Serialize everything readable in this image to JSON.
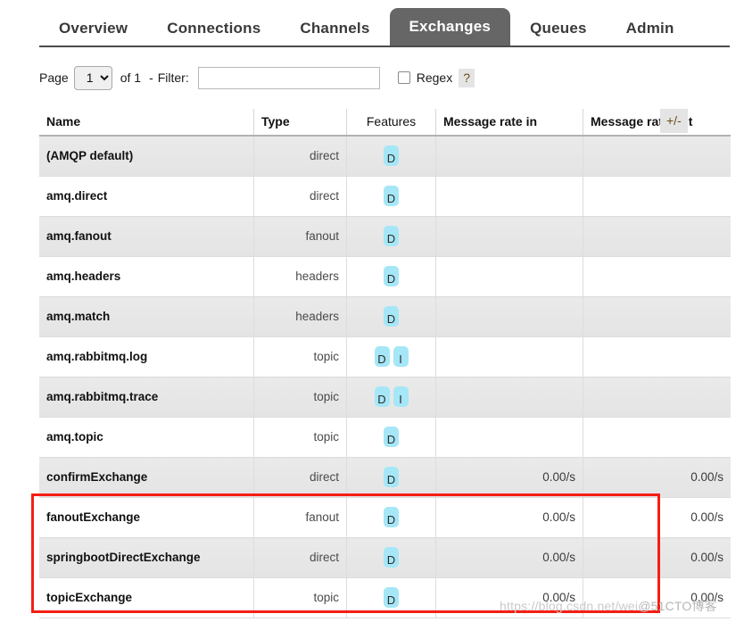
{
  "nav": {
    "tabs": [
      {
        "label": "Overview",
        "active": false
      },
      {
        "label": "Connections",
        "active": false
      },
      {
        "label": "Channels",
        "active": false
      },
      {
        "label": "Exchanges",
        "active": true
      },
      {
        "label": "Queues",
        "active": false
      },
      {
        "label": "Admin",
        "active": false
      }
    ]
  },
  "toolbar": {
    "page_label": "Page",
    "page_value": "1",
    "page_options": [
      "1"
    ],
    "of_label": "of 1",
    "dash_label": "-",
    "filter_label": "Filter:",
    "filter_value": "",
    "filter_placeholder": "",
    "regex_label": "Regex",
    "regex_checked": false,
    "help_label": "?"
  },
  "table": {
    "columns": [
      "Name",
      "Type",
      "Features",
      "Message rate in",
      "Message rate out"
    ],
    "plus_minus_label": "+/-",
    "rows": [
      {
        "name": "(AMQP default)",
        "type": "direct",
        "features": [
          "D"
        ],
        "rate_in": "",
        "rate_out": ""
      },
      {
        "name": "amq.direct",
        "type": "direct",
        "features": [
          "D"
        ],
        "rate_in": "",
        "rate_out": ""
      },
      {
        "name": "amq.fanout",
        "type": "fanout",
        "features": [
          "D"
        ],
        "rate_in": "",
        "rate_out": ""
      },
      {
        "name": "amq.headers",
        "type": "headers",
        "features": [
          "D"
        ],
        "rate_in": "",
        "rate_out": ""
      },
      {
        "name": "amq.match",
        "type": "headers",
        "features": [
          "D"
        ],
        "rate_in": "",
        "rate_out": ""
      },
      {
        "name": "amq.rabbitmq.log",
        "type": "topic",
        "features": [
          "D",
          "I"
        ],
        "rate_in": "",
        "rate_out": ""
      },
      {
        "name": "amq.rabbitmq.trace",
        "type": "topic",
        "features": [
          "D",
          "I"
        ],
        "rate_in": "",
        "rate_out": ""
      },
      {
        "name": "amq.topic",
        "type": "topic",
        "features": [
          "D"
        ],
        "rate_in": "",
        "rate_out": ""
      },
      {
        "name": "confirmExchange",
        "type": "direct",
        "features": [
          "D"
        ],
        "rate_in": "0.00/s",
        "rate_out": "0.00/s"
      },
      {
        "name": "fanoutExchange",
        "type": "fanout",
        "features": [
          "D"
        ],
        "rate_in": "0.00/s",
        "rate_out": "0.00/s"
      },
      {
        "name": "springbootDirectExchange",
        "type": "direct",
        "features": [
          "D"
        ],
        "rate_in": "0.00/s",
        "rate_out": "0.00/s"
      },
      {
        "name": "topicExchange",
        "type": "topic",
        "features": [
          "D"
        ],
        "rate_in": "0.00/s",
        "rate_out": "0.00/s"
      }
    ]
  },
  "watermark": {
    "url": "https://blog.csdn.net/wei",
    "suffix": "@51CTO博客"
  },
  "colors": {
    "active_tab_bg": "#666666",
    "badge_bg": "#a5e7f7",
    "highlight_border": "#f51e14",
    "row_alt_bg": "#e8e8e8"
  }
}
